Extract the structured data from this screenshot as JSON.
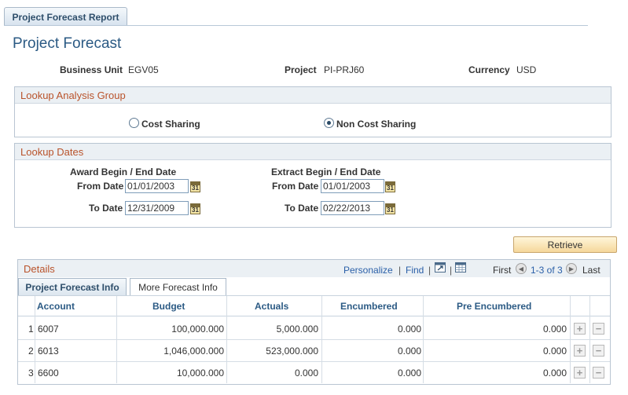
{
  "tab": {
    "label": "Project Forecast Report"
  },
  "page_title": "Project Forecast",
  "header_fields": {
    "business_unit": {
      "label": "Business Unit",
      "value": "EGV05"
    },
    "project": {
      "label": "Project",
      "value": "PI-PRJ60"
    },
    "currency": {
      "label": "Currency",
      "value": "USD"
    }
  },
  "lookup_analysis_group": {
    "title": "Lookup Analysis Group",
    "options": [
      {
        "label": "Cost Sharing",
        "selected": false
      },
      {
        "label": "Non Cost Sharing",
        "selected": true
      }
    ]
  },
  "lookup_dates": {
    "title": "Lookup Dates",
    "award": {
      "heading": "Award Begin / End Date",
      "from_label": "From Date",
      "from_value": "01/01/2003",
      "to_label": "To Date",
      "to_value": "12/31/2009"
    },
    "extract": {
      "heading": "Extract Begin / End Date",
      "from_label": "From Date",
      "from_value": "01/01/2003",
      "to_label": "To Date",
      "to_value": "02/22/2013"
    },
    "calendar_icon_text": "31"
  },
  "retrieve_label": "Retrieve",
  "details": {
    "title": "Details",
    "personalize": "Personalize",
    "separator": "|",
    "find": "Find",
    "first": "First",
    "range": "1-3 of 3",
    "last": "Last",
    "tabs": [
      "Project Forecast Info",
      "More Forecast Info"
    ],
    "columns": [
      "Account",
      "Budget",
      "Actuals",
      "Encumbered",
      "Pre Encumbered"
    ],
    "rows": [
      {
        "num": "1",
        "account": "6007",
        "budget": "100,000.000",
        "actuals": "5,000.000",
        "encumbered": "0.000",
        "pre_encumbered": "0.000"
      },
      {
        "num": "2",
        "account": "6013",
        "budget": "1,046,000.000",
        "actuals": "523,000.000",
        "encumbered": "0.000",
        "pre_encumbered": "0.000"
      },
      {
        "num": "3",
        "account": "6600",
        "budget": "10,000.000",
        "actuals": "0.000",
        "encumbered": "0.000",
        "pre_encumbered": "0.000"
      }
    ],
    "add_symbol": "+",
    "delete_symbol": "−"
  },
  "icons": {
    "calendar": "calendar-icon",
    "zoom": "new-window-icon",
    "grid": "spreadsheet-icon",
    "prev": "previous-arrow-icon",
    "next": "next-arrow-icon"
  },
  "colors": {
    "title_blue": "#2b5a84",
    "section_header": "#b9532b",
    "link_blue": "#2a5fa8",
    "button_gold": "#f5d79b"
  }
}
